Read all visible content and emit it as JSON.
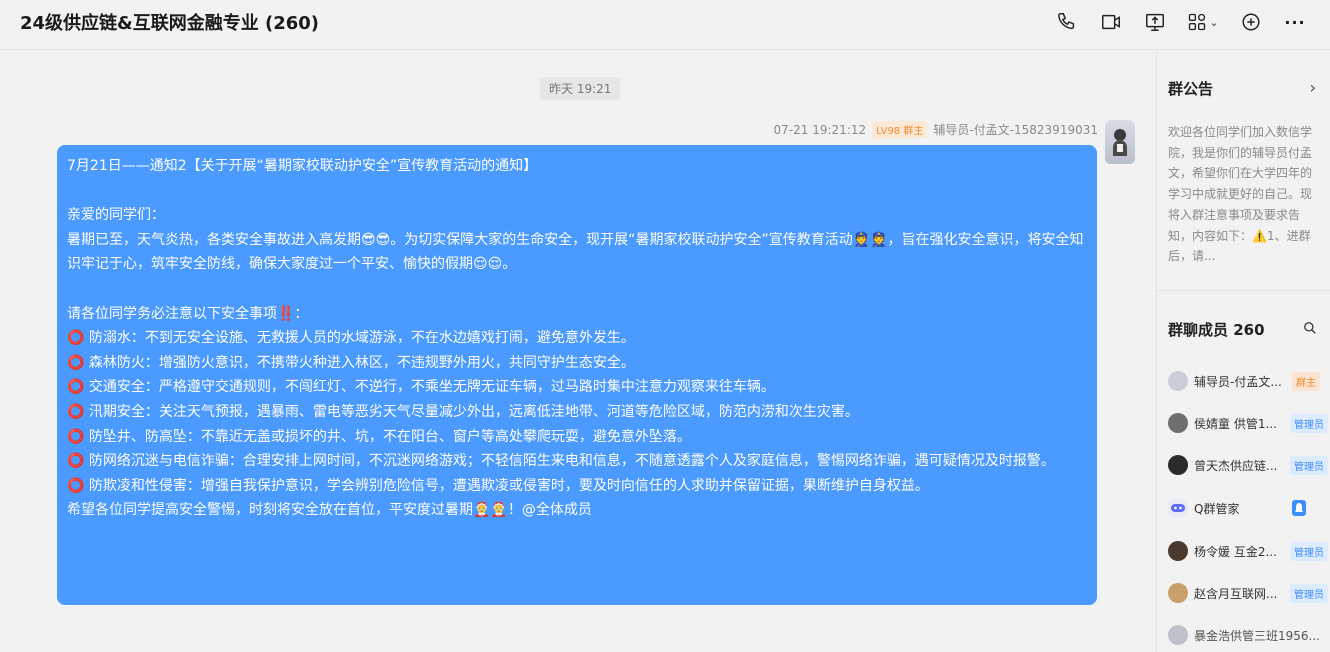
{
  "window": {
    "title": "24级供应链&互联网金融专业 (260)"
  },
  "toolbar": {
    "icons": [
      "phone-icon",
      "video-icon",
      "screen-share-icon",
      "apps-icon",
      "add-icon",
      "more-icon"
    ],
    "apps_chevron": "⌄",
    "more_label": "···"
  },
  "chat": {
    "time_divider": "昨天 19:21",
    "message": {
      "timestamp": "07-21 19:21:12",
      "level_badge": "LV98 群主",
      "sender": "辅导员-付孟文-15823919031",
      "lines": [
        "7月21日——通知2【关于开展“暑期家校联动护安全”宣传教育活动的通知】",
        "",
        "亲爱的同学们：",
        "      暑期已至，天气炎热，各类安全事故进入高发期😎😎。为切实保障大家的生命安全，现开展“暑期家校联动护安全”宣传教育活动👮👮，旨在强化安全意识，将安全知",
        "识牢记于心，筑牢安全防线，确保大家度过一个平安、愉快的假期😌😌。",
        "",
        "请各位同学务必注意以下安全事项‼️：",
        "⭕ 防溺水：不到无安全设施、无救援人员的水域游泳，不在水边嬉戏打闹，避免意外发生。",
        "⭕ 森林防火：增强防火意识，不携带火种进入林区，不违规野外用火，共同守护生态安全。",
        "⭕ 交通安全：严格遵守交通规则，不闯红灯、不逆行，不乘坐无牌无证车辆，过马路时集中注意力观察来往车辆。",
        "⭕ 汛期安全：关注天气预报，遇暴雨、雷电等恶劣天气尽量减少外出，远离低洼地带、河道等危险区域，防范内涝和次生灾害。",
        "⭕ 防坠井、防高坠：不靠近无盖或损坏的井、坑，不在阳台、窗户等高处攀爬玩耍，避免意外坠落。",
        "⭕ 防网络沉迷与电信诈骗：合理安排上网时间，不沉迷网络游戏；不轻信陌生来电和信息，不随意透露个人及家庭信息，警惕网络诈骗，遇可疑情况及时报警。",
        "⭕ 防欺凌和性侵害：增强自我保护意识，学会辨别危险信号，遭遇欺凌或侵害时，要及时向信任的人求助并保留证据，果断维护自身权益。",
        "      希望各位同学提高安全警惕，时刻将安全放在首位，平安度过暑期🤶🤶！@全体成员"
      ]
    }
  },
  "sidebar": {
    "announcement_title": "群公告",
    "announcement_arrow": "›",
    "announcement_text": "欢迎各位同学们加入数信学院，我是你们的辅导员付孟文，希望你们在大学四年的学习中成就更好的自己。现将入群注意事项及要求告知，内容如下：⚠️1、进群后，请...",
    "members_title": "群聊成员 260",
    "members": [
      {
        "name": "辅导员-付孟文...",
        "badge": "群主",
        "badge_type": "owner",
        "avatar_color": "#c9ced8"
      },
      {
        "name": "侯婧童 供管1...",
        "badge": "管理员",
        "badge_type": "admin",
        "avatar_color": "#6f6f6f"
      },
      {
        "name": "曾天杰供应链...",
        "badge": "管理员",
        "badge_type": "admin",
        "avatar_color": "#2b2b2b"
      },
      {
        "name": "Q群管家",
        "badge": "",
        "badge_type": "bot",
        "avatar_color": "#5b6cf0"
      },
      {
        "name": "杨令媛 互金2...",
        "badge": "管理员",
        "badge_type": "admin",
        "avatar_color": "#4a3a2c"
      },
      {
        "name": "赵含月互联网...",
        "badge": "管理员",
        "badge_type": "admin",
        "avatar_color": "#c7a06a"
      },
      {
        "name": "暴金浩供管三班1956...",
        "badge": "",
        "badge_type": "none",
        "avatar_color": "#bfc3c9"
      }
    ]
  }
}
